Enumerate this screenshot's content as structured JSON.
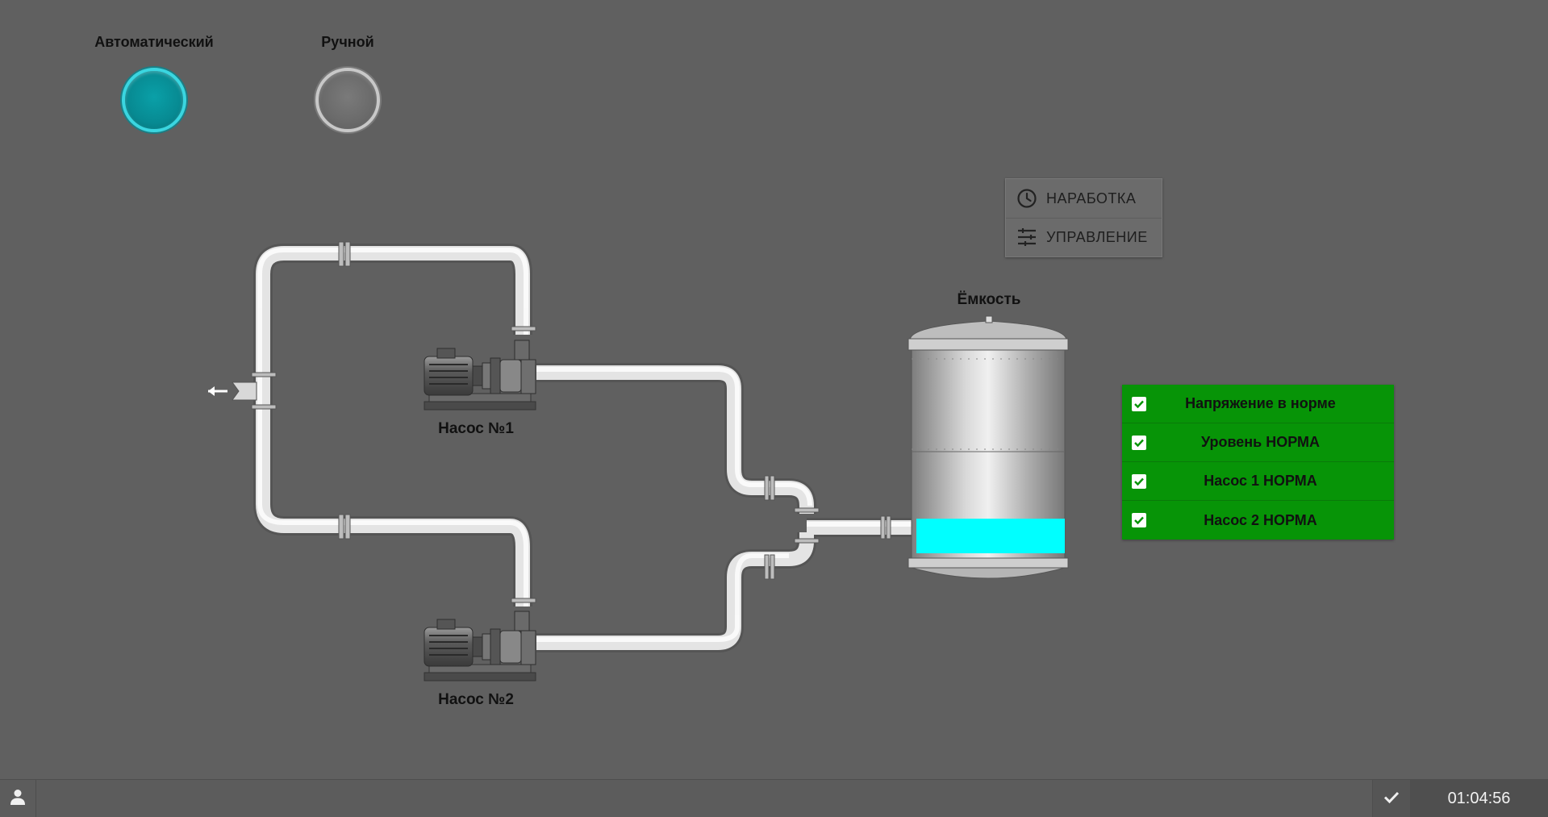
{
  "modes": {
    "auto_label": "Автоматический",
    "manual_label": "Ручной"
  },
  "menu": {
    "runtime_label": "НАРАБОТКА",
    "control_label": "УПРАВЛЕНИЕ"
  },
  "equipment": {
    "pump1_label": "Насос №1",
    "pump2_label": "Насос №2",
    "tank_label": "Ёмкость",
    "tank_level": 0.17
  },
  "status": {
    "items": [
      {
        "label": "Напряжение в норме"
      },
      {
        "label": "Уровень НОРМА"
      },
      {
        "label": "Насос 1 НОРМА"
      },
      {
        "label": "Насос 2 НОРМА"
      }
    ]
  },
  "footer": {
    "time": "01:04:56"
  },
  "colors": {
    "background": "#606060",
    "auto_active": "#078a92",
    "status_ok": "#079407",
    "tank_liquid": "#00ffff"
  },
  "icons": {
    "runtime": "clock-icon",
    "control": "sliders-icon",
    "user": "user-icon",
    "ack": "check-icon"
  }
}
